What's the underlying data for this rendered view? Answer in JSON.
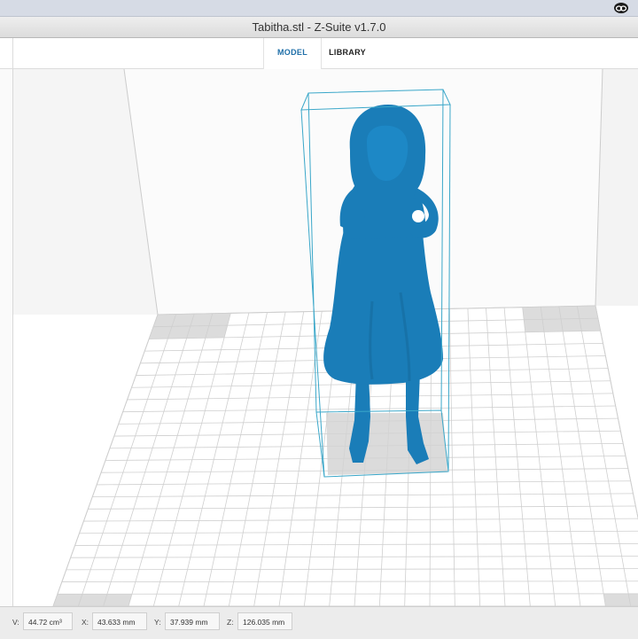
{
  "window": {
    "title": "Tabitha.stl - Z-Suite v1.7.0"
  },
  "tabs": [
    {
      "label": "MODEL",
      "active": true
    },
    {
      "label": "LIBRARY",
      "active": false
    }
  ],
  "model": {
    "name": "Tabitha.stl",
    "color": "#1a7db8"
  },
  "status": {
    "volume_label": "V:",
    "volume_value": "44.72 cm³",
    "x_label": "X:",
    "x_value": "43.633 mm",
    "y_label": "Y:",
    "y_value": "37.939 mm",
    "z_label": "Z:",
    "z_value": "126.035 mm"
  },
  "colors": {
    "accent": "#1f6fa8",
    "model": "#1a7db8",
    "bbox": "#3aa7c9"
  }
}
